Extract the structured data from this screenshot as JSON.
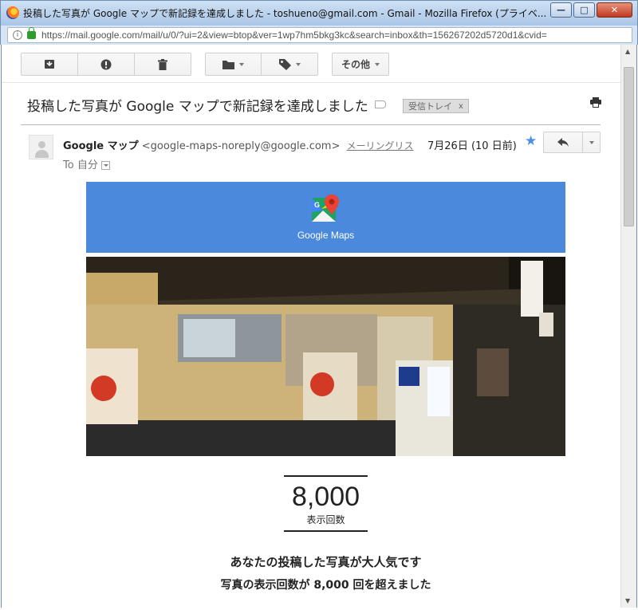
{
  "window": {
    "title": "投稿した写真が Google マップで新記録を達成しました - toshueno@gmail.com - Gmail - Mozilla Firefox (プライベ...",
    "url": "https://mail.google.com/mail/u/0/?ui=2&view=btop&ver=1wp7hm5bkg3kc&search=inbox&th=156267202d5720d1&cvid="
  },
  "toolbar": {
    "more_label": "その他"
  },
  "email": {
    "subject": "投稿した写真が Google マップで新記録を達成しました",
    "label_chip": "受信トレイ",
    "chip_close": "x",
    "sender_name": "Google マップ",
    "sender_email": "<google-maps-noreply@google.com>",
    "mailing_list": "メーリングリス",
    "date": "7月26日 (10 日前)",
    "to_line": "To 自分"
  },
  "content": {
    "brand": "Google Maps",
    "stat_value": "8,000",
    "stat_label": "表示回数",
    "headline": "あなたの投稿した写真が大人気です",
    "subline": "写真の表示回数が 8,000 回を超えました"
  },
  "colors": {
    "banner": "#4a89dc",
    "star": "#4d8ee8"
  }
}
